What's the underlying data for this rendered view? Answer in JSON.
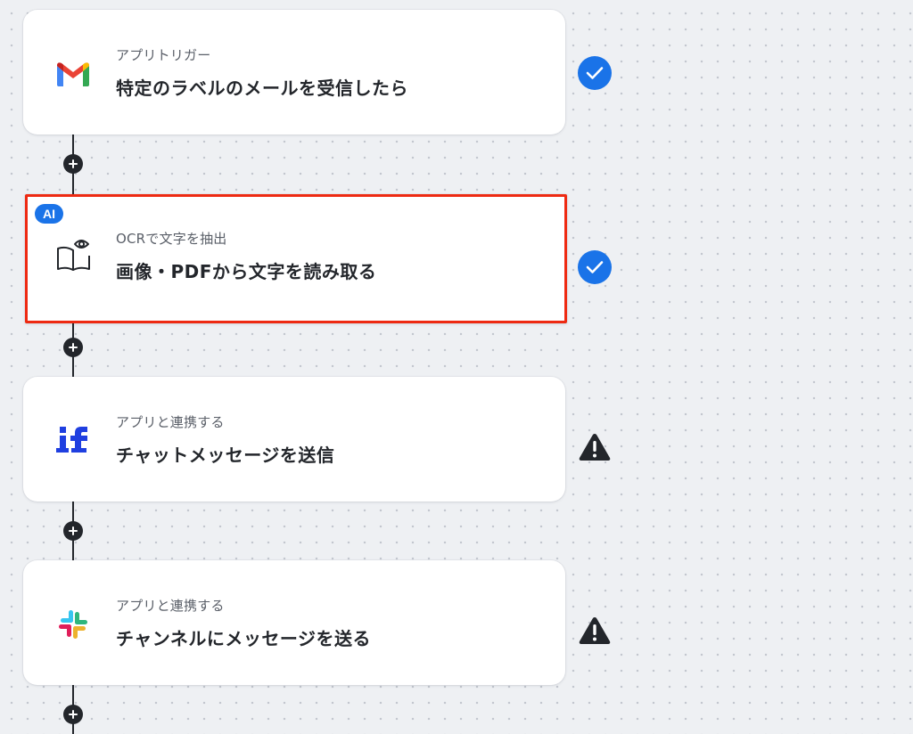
{
  "flow": {
    "steps": [
      {
        "subtitle": "アプリトリガー",
        "title": "特定のラベルのメールを受信したら",
        "icon": "gmail-icon",
        "status": "complete"
      },
      {
        "badge": "AI",
        "subtitle": "OCRで文字を抽出",
        "title": "画像・PDFから文字を読み取る",
        "icon": "book-eye-icon",
        "status": "complete",
        "selected": true
      },
      {
        "subtitle": "アプリと連携する",
        "title": "チャットメッセージを送信",
        "icon": "if-app-icon",
        "status": "warning"
      },
      {
        "subtitle": "アプリと連携する",
        "title": "チャンネルにメッセージを送る",
        "icon": "slack-icon",
        "status": "warning"
      }
    ]
  },
  "colors": {
    "accent_blue": "#1a73e8",
    "selection_red": "#ee2a12",
    "connector": "#23262b",
    "warning": "#23262b"
  }
}
